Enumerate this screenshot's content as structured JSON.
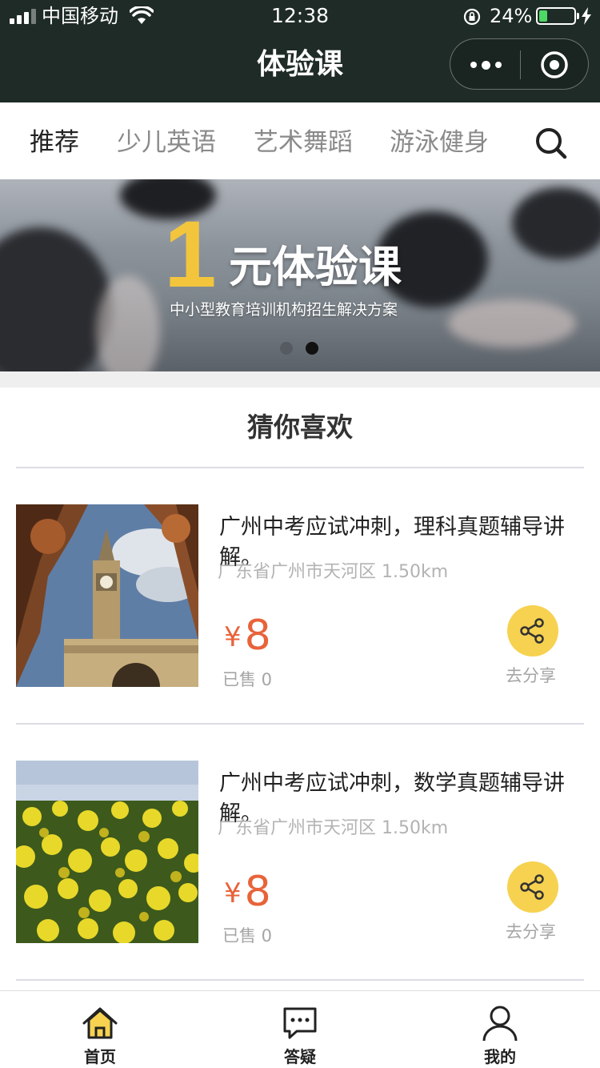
{
  "status_bar": {
    "carrier": "中国移动",
    "time": "12:38",
    "battery_percent": "24%",
    "battery_level": 0.24
  },
  "nav": {
    "title": "体验课"
  },
  "tabs": [
    {
      "label": "推荐",
      "active": true
    },
    {
      "label": "少儿英语",
      "active": false
    },
    {
      "label": "艺术舞蹈",
      "active": false
    },
    {
      "label": "游泳健身",
      "active": false
    }
  ],
  "banner": {
    "big_number": "1",
    "title": "元体验课",
    "subtitle": "中小型教育培训机构招生解决方案",
    "slide_count": 2,
    "active_slide": 2
  },
  "section": {
    "title": "猜你喜欢"
  },
  "products": [
    {
      "title": "广州中考应试冲刺，理科真题辅导讲解。",
      "location": "广东省广州市天河区 1.50km",
      "currency": "¥",
      "price": "8",
      "sold": "已售 0",
      "share_label": "去分享"
    },
    {
      "title": "广州中考应试冲刺，数学真题辅导讲解。",
      "location": "广东省广州市天河区 1.50km",
      "currency": "¥",
      "price": "8",
      "sold": "已售 0",
      "share_label": "去分享"
    }
  ],
  "tabbar": [
    {
      "label": "首页",
      "icon": "home-icon",
      "active": true
    },
    {
      "label": "答疑",
      "icon": "chat-icon",
      "active": false
    },
    {
      "label": "我的",
      "icon": "user-icon",
      "active": false
    }
  ],
  "colors": {
    "nav_bg": "#1f2b26",
    "price": "#e8633a",
    "share_button": "#f6d250",
    "banner_accent": "#f2c53d",
    "home_icon_fill": "#f6d250"
  }
}
